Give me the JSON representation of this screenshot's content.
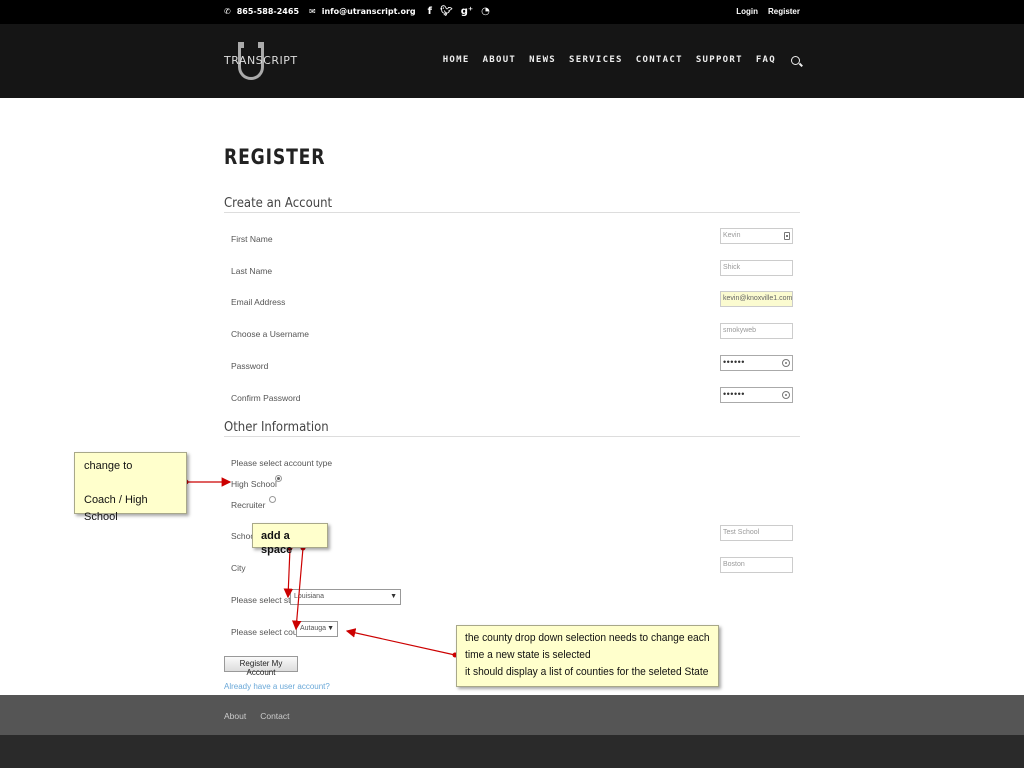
{
  "topbar": {
    "phone": "865-588-2465",
    "email": "info@utranscript.org",
    "social_icons": [
      "facebook-icon",
      "twitter-icon",
      "google-plus-icon",
      "rss-icon"
    ],
    "login": "Login",
    "register": "Register"
  },
  "header": {
    "logo_text": "TRANSCRIPT",
    "nav": [
      "HOME",
      "ABOUT",
      "NEWS",
      "SERVICES",
      "CONTACT",
      "SUPPORT",
      "FAQ"
    ]
  },
  "page": {
    "title": "REGISTER",
    "account_section": "Create an Account",
    "other_section": "Other Information"
  },
  "fields": {
    "first_name": {
      "label": "First Name",
      "value": "Kevin"
    },
    "last_name": {
      "label": "Last Name",
      "value": "Shick"
    },
    "email": {
      "label": "Email Address",
      "value": "kevin@knoxville1.com"
    },
    "username": {
      "label": "Choose a Username",
      "value": "smokyweb"
    },
    "password": {
      "label": "Password",
      "value": "••••••"
    },
    "confirm_password": {
      "label": "Confirm Password",
      "value": "••••••"
    },
    "account_type_label": "Please select account type",
    "account_types": [
      {
        "label": "High School",
        "checked": true
      },
      {
        "label": "Recruiter",
        "checked": false
      }
    ],
    "school": {
      "label": "School",
      "value": "Test School"
    },
    "city": {
      "label": "City",
      "value": "Boston"
    },
    "state": {
      "label": "Please select state",
      "value": "Louisiana"
    },
    "county": {
      "label": "Please select county",
      "value": "Autauga"
    }
  },
  "actions": {
    "register_button": "Register My Account",
    "login_link": "Already have a user account?"
  },
  "footer": {
    "links": [
      "About",
      "Contact"
    ]
  },
  "annotations": {
    "note1": {
      "line1": "change to",
      "line2": "Coach / High School"
    },
    "note2": "add a space",
    "note3": [
      "the county drop down selection needs to change each",
      "time a new state is selected",
      "it should display a list of counties for the seleted State"
    ]
  },
  "colors": {
    "arrow": "#cc0000",
    "note_bg": "#ffffcc",
    "link": "#6aa8d8"
  }
}
